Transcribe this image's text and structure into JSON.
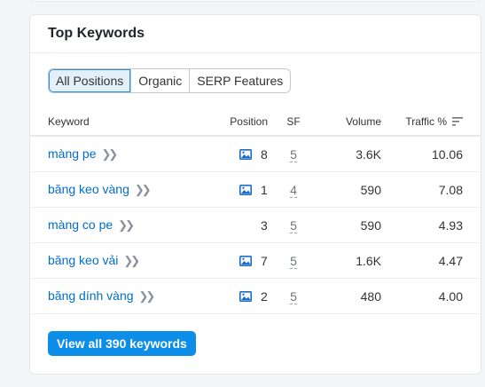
{
  "card": {
    "title": "Top Keywords"
  },
  "tabs": [
    {
      "label": "All Positions",
      "active": true
    },
    {
      "label": "Organic",
      "active": false
    },
    {
      "label": "SERP Features",
      "active": false
    }
  ],
  "table": {
    "columns": {
      "keyword": "Keyword",
      "position": "Position",
      "sf": "SF",
      "volume": "Volume",
      "traffic": "Traffic %"
    },
    "rows": [
      {
        "keyword": "màng pe",
        "has_image_feature": true,
        "position": "8",
        "sf": "5",
        "volume": "3.6K",
        "traffic": "10.06"
      },
      {
        "keyword": "băng keo vàng",
        "has_image_feature": true,
        "position": "1",
        "sf": "4",
        "volume": "590",
        "traffic": "7.08"
      },
      {
        "keyword": "màng co pe",
        "has_image_feature": false,
        "position": "3",
        "sf": "5",
        "volume": "590",
        "traffic": "4.93"
      },
      {
        "keyword": "băng keo vải",
        "has_image_feature": true,
        "position": "7",
        "sf": "5",
        "volume": "1.6K",
        "traffic": "4.47"
      },
      {
        "keyword": "băng dính vàng",
        "has_image_feature": true,
        "position": "2",
        "sf": "5",
        "volume": "480",
        "traffic": "4.00"
      }
    ]
  },
  "view_all_button": {
    "label": "View all 390 keywords"
  },
  "colors": {
    "link": "#006dca",
    "primary_button": "#0c8ee8",
    "active_tab_bg": "#e3f0fa",
    "active_tab_border": "#2f8bd6"
  },
  "icons": {
    "serp_feature": "image-icon",
    "keyword_more": "double-chevron-right-icon",
    "sort": "sort-descending-icon"
  }
}
